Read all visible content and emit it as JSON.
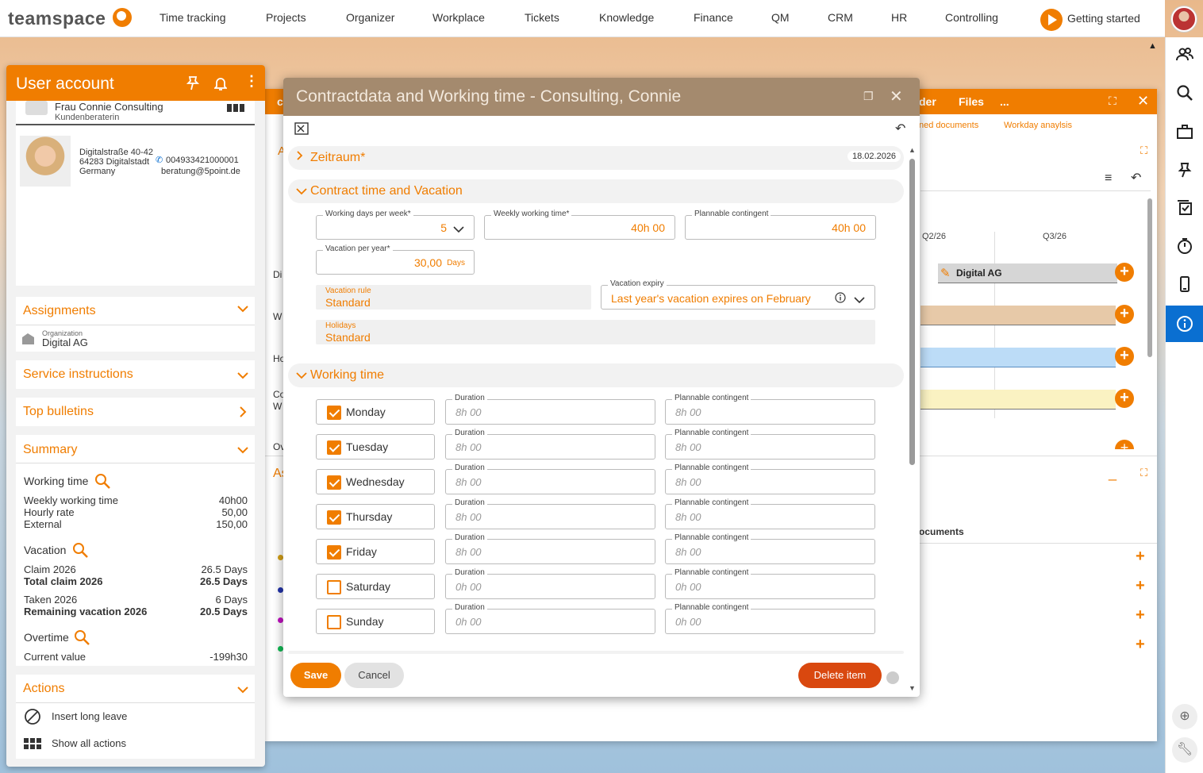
{
  "topnav": {
    "logo": "teamspace",
    "items": [
      "Time tracking",
      "Projects",
      "Organizer",
      "Workplace",
      "Tickets",
      "Knowledge",
      "Finance",
      "QM",
      "CRM",
      "HR",
      "Controlling"
    ],
    "getting_started": "Getting started"
  },
  "user_panel": {
    "title": "User account",
    "name": "Frau Connie Consulting",
    "role": "Kundenberaterin",
    "address": [
      "Digitalstraße 40-42",
      "64283 Digitalstadt",
      "Germany"
    ],
    "phone": "004933421000001",
    "email": "beratung@5point.de",
    "assignments": {
      "title": "Assignments",
      "org_label": "Organization",
      "org_value": "Digital AG"
    },
    "service_instructions": "Service instructions",
    "top_bulletins": "Top bulletins",
    "summary": {
      "title": "Summary",
      "working_time": "Working time",
      "rows1": [
        {
          "label": "Weekly working time",
          "value": "40h00"
        },
        {
          "label": "Hourly rate",
          "value": "50,00"
        },
        {
          "label": "External",
          "value": "150,00"
        }
      ],
      "vacation": "Vacation",
      "claim_label": "Claim 2026",
      "claim_value": "26.5 Days",
      "total_label": "Total claim 2026",
      "total_value": "26.5 Days",
      "taken_label": "Taken 2026",
      "taken_value": "6 Days",
      "remaining_label": "Remaining vacation 2026",
      "remaining_value": "20.5 Days",
      "overtime": "Overtime",
      "current_label": "Current value",
      "current_value": "-199h30"
    },
    "actions": {
      "title": "Actions",
      "items": [
        "Insert long leave",
        "Show all actions"
      ]
    }
  },
  "bg_window": {
    "header_left": "c",
    "header_items": [
      "der",
      "Files",
      "..."
    ],
    "links": [
      "ned documents",
      "Workday anaylsis"
    ],
    "left_fragments": [
      "A",
      "A",
      "Di",
      "W",
      "Ho",
      "Co",
      "W",
      "Ov",
      "As"
    ],
    "quarters": [
      "Q2/26",
      "Q3/26"
    ],
    "bar_label": "Digital AG",
    "documents_label": "ocuments"
  },
  "dialog": {
    "title": "Contractdata and Working time - Consulting, Connie",
    "zeitraum": {
      "title": "Zeitraum*",
      "date": "18.02.2026"
    },
    "contract": {
      "title": "Contract time and Vacation",
      "working_days": {
        "label": "Working days per week*",
        "value": "5"
      },
      "weekly_time": {
        "label": "Weekly working time*",
        "value": "40h 00"
      },
      "plannable": {
        "label": "Plannable contingent",
        "value": "40h 00"
      },
      "vacation_per_year": {
        "label": "Vacation per year*",
        "value": "30,00",
        "unit": "Days"
      },
      "vacation_rule": {
        "label": "Vacation rule",
        "value": "Standard"
      },
      "vacation_expiry": {
        "label": "Vacation expiry",
        "value": "Last year's vacation expires on February"
      },
      "holidays": {
        "label": "Holidays",
        "value": "Standard"
      }
    },
    "working_time": {
      "title": "Working time",
      "duration_label": "Duration",
      "contingent_label": "Plannable contingent",
      "days": [
        {
          "name": "Monday",
          "checked": true,
          "duration": "8h 00",
          "contingent": "8h 00"
        },
        {
          "name": "Tuesday",
          "checked": true,
          "duration": "8h 00",
          "contingent": "8h 00"
        },
        {
          "name": "Wednesday",
          "checked": true,
          "duration": "8h 00",
          "contingent": "8h 00"
        },
        {
          "name": "Thursday",
          "checked": true,
          "duration": "8h 00",
          "contingent": "8h 00"
        },
        {
          "name": "Friday",
          "checked": true,
          "duration": "8h 00",
          "contingent": "8h 00"
        },
        {
          "name": "Saturday",
          "checked": false,
          "duration": "0h 00",
          "contingent": "0h 00"
        },
        {
          "name": "Sunday",
          "checked": false,
          "duration": "0h 00",
          "contingent": "0h 00"
        }
      ]
    },
    "buttons": {
      "save": "Save",
      "cancel": "Cancel",
      "delete": "Delete item"
    }
  },
  "colors": {
    "accent": "#f07d00",
    "dialog_header": "#a48a6e",
    "info_blue": "#0a6fd1",
    "delete_red": "#d9480f"
  }
}
